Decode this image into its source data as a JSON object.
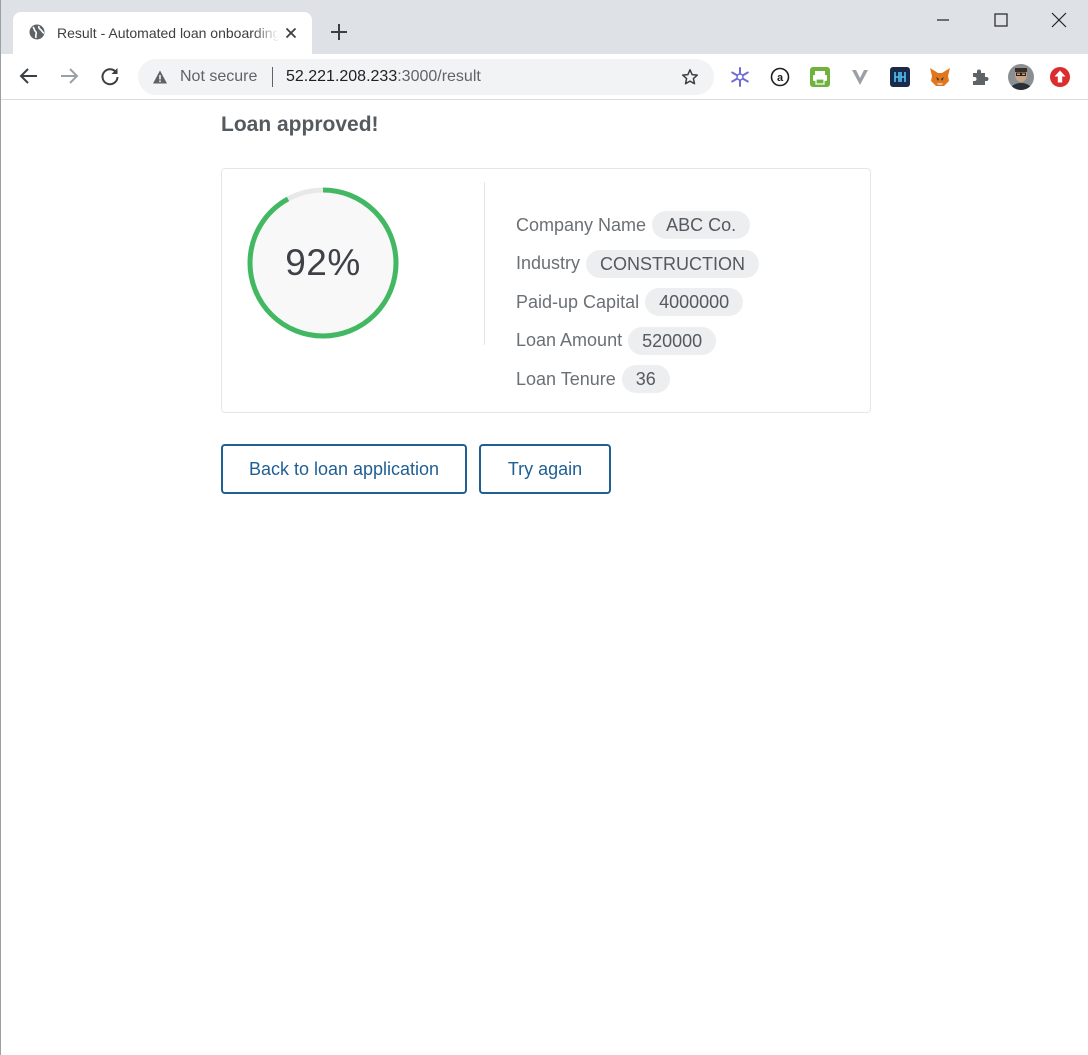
{
  "browser": {
    "tab_title": "Result - Automated loan onboarding",
    "omnibox": {
      "security_text": "Not secure",
      "url_host": "52.221.208.233",
      "url_rest": ":3000/result"
    },
    "extensions": [
      "snowflake-extension-icon",
      "a-circle-extension-icon",
      "printer-extension-icon",
      "v-extension-icon",
      "lf-extension-icon",
      "metamask-fox-icon",
      "puzzle-icon",
      "profile-avatar",
      "red-up-arrow-extension-icon"
    ]
  },
  "page": {
    "heading": "Loan approved!",
    "score": {
      "label": "92%",
      "percent": 92,
      "color": "#42b862",
      "track_color": "#e8e8e8"
    },
    "fields": [
      {
        "label": "Company Name",
        "value": "ABC Co."
      },
      {
        "label": "Industry",
        "value": "CONSTRUCTION"
      },
      {
        "label": "Paid-up Capital",
        "value": "4000000"
      },
      {
        "label": "Loan Amount",
        "value": "520000"
      },
      {
        "label": "Loan Tenure",
        "value": "36"
      }
    ],
    "buttons": {
      "back": "Back to loan application",
      "retry": "Try again"
    },
    "accent_color": "#1f5f94"
  }
}
